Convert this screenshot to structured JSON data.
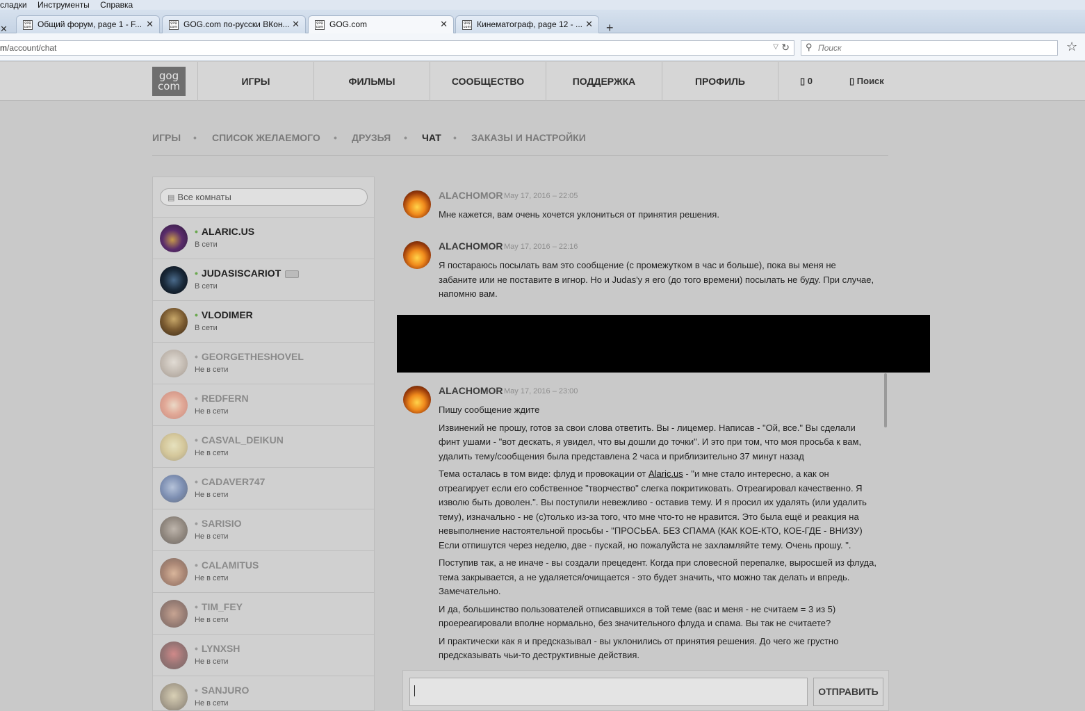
{
  "browser": {
    "menu": [
      "сладки",
      "Инструменты",
      "Справка"
    ],
    "tabs": [
      {
        "label": "Общий форум, page 1 - F...",
        "active": false
      },
      {
        "label": "GOG.com по-русски ВКон...",
        "active": false
      },
      {
        "label": "GOG.com",
        "active": true
      },
      {
        "label": "Кинематограф, page 12 - ...",
        "active": false
      }
    ],
    "url_prefix": "m",
    "url_path": "/account/chat",
    "search_placeholder": "Поиск",
    "favicon_text": "gog com"
  },
  "site": {
    "logo_top": "gog",
    "logo_bottom": "com",
    "nav": [
      "ИГРЫ",
      "ФИЛЬМЫ",
      "СООБЩЕСТВО",
      "ПОДДЕРЖКА",
      "ПРОФИЛЬ"
    ],
    "cart_count": "0",
    "search_label": "Поиск"
  },
  "subnav": {
    "items": [
      "ИГРЫ",
      "СПИСОК ЖЕЛАЕМОГО",
      "ДРУЗЬЯ",
      "ЧАТ",
      "ЗАКАЗЫ И НАСТРОЙКИ"
    ],
    "current": "ЧАТ",
    "separator": "•"
  },
  "sidebar": {
    "room_search_placeholder": "Все комнаты",
    "friends": [
      {
        "name": "ALARIC.US",
        "status": "В сети",
        "online": true
      },
      {
        "name": "JUDASISCARIOT",
        "status": "В сети",
        "online": true
      },
      {
        "name": "VLODIMER",
        "status": "В сети",
        "online": true
      },
      {
        "name": "GEORGETHESHOVEL",
        "status": "Не в сети",
        "online": false
      },
      {
        "name": "REDFERN",
        "status": "Не в сети",
        "online": false
      },
      {
        "name": "CASVAL_DEIKUN",
        "status": "Не в сети",
        "online": false
      },
      {
        "name": "CADAVER747",
        "status": "Не в сети",
        "online": false
      },
      {
        "name": "SARISIO",
        "status": "Не в сети",
        "online": false
      },
      {
        "name": "CALAMITUS",
        "status": "Не в сети",
        "online": false
      },
      {
        "name": "TIM_FEY",
        "status": "Не в сети",
        "online": false
      },
      {
        "name": "LYNXSH",
        "status": "Не в сети",
        "online": false
      },
      {
        "name": "SANJURO",
        "status": "Не в сети",
        "online": false
      }
    ]
  },
  "chat": {
    "messages": [
      {
        "author": "ALACHOMOR",
        "time": "May 17, 2016 – 22:05",
        "paragraphs": [
          "Мне кажется, вам очень хочется уклониться от принятия решения."
        ]
      },
      {
        "author": "ALACHOMOR",
        "time": "May 17, 2016 – 22:16",
        "paragraphs": [
          "Я постараюсь посылать вам это сообщение (с промежутком в час и больше), пока вы меня не забаните или не поставите в игнор. Но и Judas'у я его (до того времени) посылать не буду. При случае, напомню вам."
        ]
      },
      {
        "author": "ALACHOMOR",
        "time": "May 17, 2016 – 23:00",
        "paragraphs": [
          "Пишу сообщение ждите",
          "Извинений не прошу, готов за свои слова ответить. Вы - лицемер. Написав - \"Ой, все.\" Вы сделали финт ушами - \"вот дескать, я увидел, что вы дошли до точки\". И это при том, что моя просьба к вам, удалить тему/сообщения была представлена 2 часа и приблизительно 37 минут назад",
          "Тема осталась в том виде: флуд и провокации от",
          "Поступив так, а не иначе - вы создали прецедент. Когда при словесной перепалке, выросшей из флуда, тема закрывается, а не удаляется/очищается - это будет значить, что можно так делать и впредь. Замечательно.",
          "И да, большинство пользователей отписавшихся в той теме (вас и меня - не считаем = 3 из 5) проереагировали вполне нормально, без значительного флуда и спама. Вы так не считаете?",
          "И практически как я и предсказывал - вы уклонились от принятия решения. До чего же грустно предсказывать чьи-то деструктивные действия."
        ],
        "link_text": "Alaric.us",
        "link_tail": " - \"и мне стало интересно, а как он отреагирует если его собственное \"творчество\" слегка покритиковать. Отреагировал качественно. Я изволю быть доволен.\". Вы поступили невежливо - оставив тему. И я просил их удалять (или удалить тему), изначально - не (с)только из-за того, что мне что-то не нравится. Это была ещё и реакция на невыполнение настоятельной просьбы - \"ПРОСЬБА. БЕЗ СПАМА (КАК КОЕ-КТО, КОЕ-ГДЕ - ВНИЗУ) Если отпишутся через неделю, две - пускай, но пожалуйста не захламляйте тему. Очень прошу. \"."
      }
    ],
    "send_label": "ОТПРАВИТЬ"
  }
}
